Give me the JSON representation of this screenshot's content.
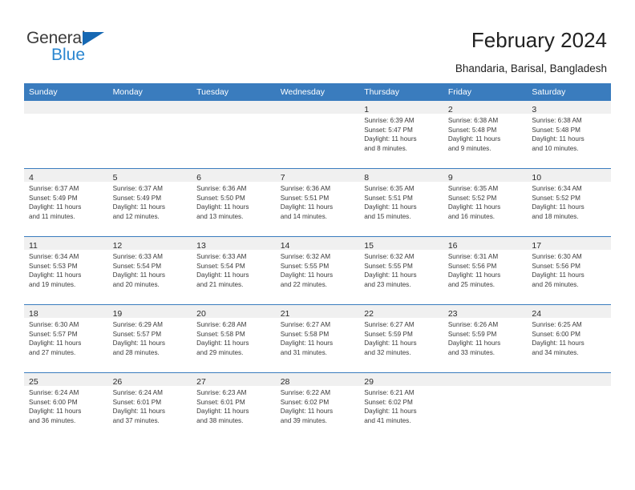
{
  "brand": {
    "name_top": "General",
    "name_bottom": "Blue",
    "color_dark": "#3b3b3b",
    "color_blue": "#2a86d0",
    "triangle_color": "#1668b3"
  },
  "header": {
    "title": "February 2024",
    "subtitle": "Bhandaria, Barisal, Bangladesh"
  },
  "theme": {
    "header_bar": "#3a7cbe",
    "daynum_band": "#f0f0f0",
    "text": "#3a3a3a"
  },
  "weekdays": [
    "Sunday",
    "Monday",
    "Tuesday",
    "Wednesday",
    "Thursday",
    "Friday",
    "Saturday"
  ],
  "weeks": [
    [
      {
        "day": "",
        "lines": []
      },
      {
        "day": "",
        "lines": []
      },
      {
        "day": "",
        "lines": []
      },
      {
        "day": "",
        "lines": []
      },
      {
        "day": "1",
        "lines": [
          "Sunrise: 6:39 AM",
          "Sunset: 5:47 PM",
          "Daylight: 11 hours",
          "and 8 minutes."
        ]
      },
      {
        "day": "2",
        "lines": [
          "Sunrise: 6:38 AM",
          "Sunset: 5:48 PM",
          "Daylight: 11 hours",
          "and 9 minutes."
        ]
      },
      {
        "day": "3",
        "lines": [
          "Sunrise: 6:38 AM",
          "Sunset: 5:48 PM",
          "Daylight: 11 hours",
          "and 10 minutes."
        ]
      }
    ],
    [
      {
        "day": "4",
        "lines": [
          "Sunrise: 6:37 AM",
          "Sunset: 5:49 PM",
          "Daylight: 11 hours",
          "and 11 minutes."
        ]
      },
      {
        "day": "5",
        "lines": [
          "Sunrise: 6:37 AM",
          "Sunset: 5:49 PM",
          "Daylight: 11 hours",
          "and 12 minutes."
        ]
      },
      {
        "day": "6",
        "lines": [
          "Sunrise: 6:36 AM",
          "Sunset: 5:50 PM",
          "Daylight: 11 hours",
          "and 13 minutes."
        ]
      },
      {
        "day": "7",
        "lines": [
          "Sunrise: 6:36 AM",
          "Sunset: 5:51 PM",
          "Daylight: 11 hours",
          "and 14 minutes."
        ]
      },
      {
        "day": "8",
        "lines": [
          "Sunrise: 6:35 AM",
          "Sunset: 5:51 PM",
          "Daylight: 11 hours",
          "and 15 minutes."
        ]
      },
      {
        "day": "9",
        "lines": [
          "Sunrise: 6:35 AM",
          "Sunset: 5:52 PM",
          "Daylight: 11 hours",
          "and 16 minutes."
        ]
      },
      {
        "day": "10",
        "lines": [
          "Sunrise: 6:34 AM",
          "Sunset: 5:52 PM",
          "Daylight: 11 hours",
          "and 18 minutes."
        ]
      }
    ],
    [
      {
        "day": "11",
        "lines": [
          "Sunrise: 6:34 AM",
          "Sunset: 5:53 PM",
          "Daylight: 11 hours",
          "and 19 minutes."
        ]
      },
      {
        "day": "12",
        "lines": [
          "Sunrise: 6:33 AM",
          "Sunset: 5:54 PM",
          "Daylight: 11 hours",
          "and 20 minutes."
        ]
      },
      {
        "day": "13",
        "lines": [
          "Sunrise: 6:33 AM",
          "Sunset: 5:54 PM",
          "Daylight: 11 hours",
          "and 21 minutes."
        ]
      },
      {
        "day": "14",
        "lines": [
          "Sunrise: 6:32 AM",
          "Sunset: 5:55 PM",
          "Daylight: 11 hours",
          "and 22 minutes."
        ]
      },
      {
        "day": "15",
        "lines": [
          "Sunrise: 6:32 AM",
          "Sunset: 5:55 PM",
          "Daylight: 11 hours",
          "and 23 minutes."
        ]
      },
      {
        "day": "16",
        "lines": [
          "Sunrise: 6:31 AM",
          "Sunset: 5:56 PM",
          "Daylight: 11 hours",
          "and 25 minutes."
        ]
      },
      {
        "day": "17",
        "lines": [
          "Sunrise: 6:30 AM",
          "Sunset: 5:56 PM",
          "Daylight: 11 hours",
          "and 26 minutes."
        ]
      }
    ],
    [
      {
        "day": "18",
        "lines": [
          "Sunrise: 6:30 AM",
          "Sunset: 5:57 PM",
          "Daylight: 11 hours",
          "and 27 minutes."
        ]
      },
      {
        "day": "19",
        "lines": [
          "Sunrise: 6:29 AM",
          "Sunset: 5:57 PM",
          "Daylight: 11 hours",
          "and 28 minutes."
        ]
      },
      {
        "day": "20",
        "lines": [
          "Sunrise: 6:28 AM",
          "Sunset: 5:58 PM",
          "Daylight: 11 hours",
          "and 29 minutes."
        ]
      },
      {
        "day": "21",
        "lines": [
          "Sunrise: 6:27 AM",
          "Sunset: 5:58 PM",
          "Daylight: 11 hours",
          "and 31 minutes."
        ]
      },
      {
        "day": "22",
        "lines": [
          "Sunrise: 6:27 AM",
          "Sunset: 5:59 PM",
          "Daylight: 11 hours",
          "and 32 minutes."
        ]
      },
      {
        "day": "23",
        "lines": [
          "Sunrise: 6:26 AM",
          "Sunset: 5:59 PM",
          "Daylight: 11 hours",
          "and 33 minutes."
        ]
      },
      {
        "day": "24",
        "lines": [
          "Sunrise: 6:25 AM",
          "Sunset: 6:00 PM",
          "Daylight: 11 hours",
          "and 34 minutes."
        ]
      }
    ],
    [
      {
        "day": "25",
        "lines": [
          "Sunrise: 6:24 AM",
          "Sunset: 6:00 PM",
          "Daylight: 11 hours",
          "and 36 minutes."
        ]
      },
      {
        "day": "26",
        "lines": [
          "Sunrise: 6:24 AM",
          "Sunset: 6:01 PM",
          "Daylight: 11 hours",
          "and 37 minutes."
        ]
      },
      {
        "day": "27",
        "lines": [
          "Sunrise: 6:23 AM",
          "Sunset: 6:01 PM",
          "Daylight: 11 hours",
          "and 38 minutes."
        ]
      },
      {
        "day": "28",
        "lines": [
          "Sunrise: 6:22 AM",
          "Sunset: 6:02 PM",
          "Daylight: 11 hours",
          "and 39 minutes."
        ]
      },
      {
        "day": "29",
        "lines": [
          "Sunrise: 6:21 AM",
          "Sunset: 6:02 PM",
          "Daylight: 11 hours",
          "and 41 minutes."
        ]
      },
      {
        "day": "",
        "lines": []
      },
      {
        "day": "",
        "lines": []
      }
    ]
  ]
}
